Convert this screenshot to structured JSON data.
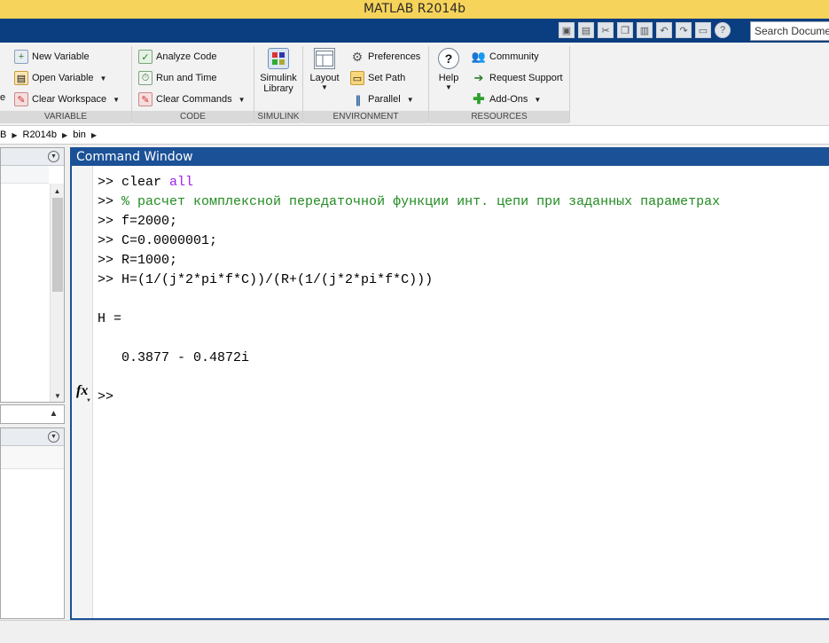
{
  "window": {
    "title": "MATLAB R2014b"
  },
  "search": {
    "placeholder": "Search Documentation"
  },
  "quick_access": [
    "layout-icon",
    "save-icon",
    "cut-icon",
    "copy-icon",
    "paste-icon",
    "undo-icon",
    "redo-icon",
    "switch-windows-icon",
    "help-icon"
  ],
  "ribbon": {
    "variable": {
      "label": "VARIABLE",
      "new_variable": "New Variable",
      "open_variable": "Open Variable",
      "clear_workspace": "Clear Workspace",
      "cut_text": "e"
    },
    "code": {
      "label": "CODE",
      "analyze_code": "Analyze Code",
      "run_and_time": "Run and Time",
      "clear_commands": "Clear Commands"
    },
    "simulink": {
      "label": "SIMULINK",
      "line1": "Simulink",
      "line2": "Library"
    },
    "environment": {
      "label": "ENVIRONMENT",
      "layout": "Layout",
      "preferences": "Preferences",
      "set_path": "Set Path",
      "parallel": "Parallel"
    },
    "resources": {
      "label": "RESOURCES",
      "help": "Help",
      "community": "Community",
      "request_support": "Request Support",
      "add_ons": "Add-Ons"
    }
  },
  "address": {
    "parts": [
      "B",
      "R2014b",
      "bin"
    ]
  },
  "command_window": {
    "title": "Command Window",
    "prompt": ">>",
    "lines": [
      {
        "prompt": ">> ",
        "text": "clear ",
        "kw": "all"
      },
      {
        "prompt": ">> ",
        "comment": "% расчет комплексной передаточной функции инт. цепи при заданных параметрах"
      },
      {
        "prompt": ">> ",
        "text": "f=2000;"
      },
      {
        "prompt": ">> ",
        "text": "C=0.0000001;"
      },
      {
        "prompt": ">> ",
        "text": "R=1000;"
      },
      {
        "prompt": ">> ",
        "text": "H=(1/(j*2*pi*f*C))/(R+(1/(j*2*pi*f*C)))"
      }
    ],
    "output_var": "H =",
    "output_value": "   0.3877 - 0.4872i",
    "fx_symbol": "fx"
  },
  "colors": {
    "titlebar": "#f6d35a",
    "tabstrip": "#0b3e80",
    "command_window_border": "#1b5196",
    "keyword": "#a020f0",
    "comment": "#228b22"
  }
}
